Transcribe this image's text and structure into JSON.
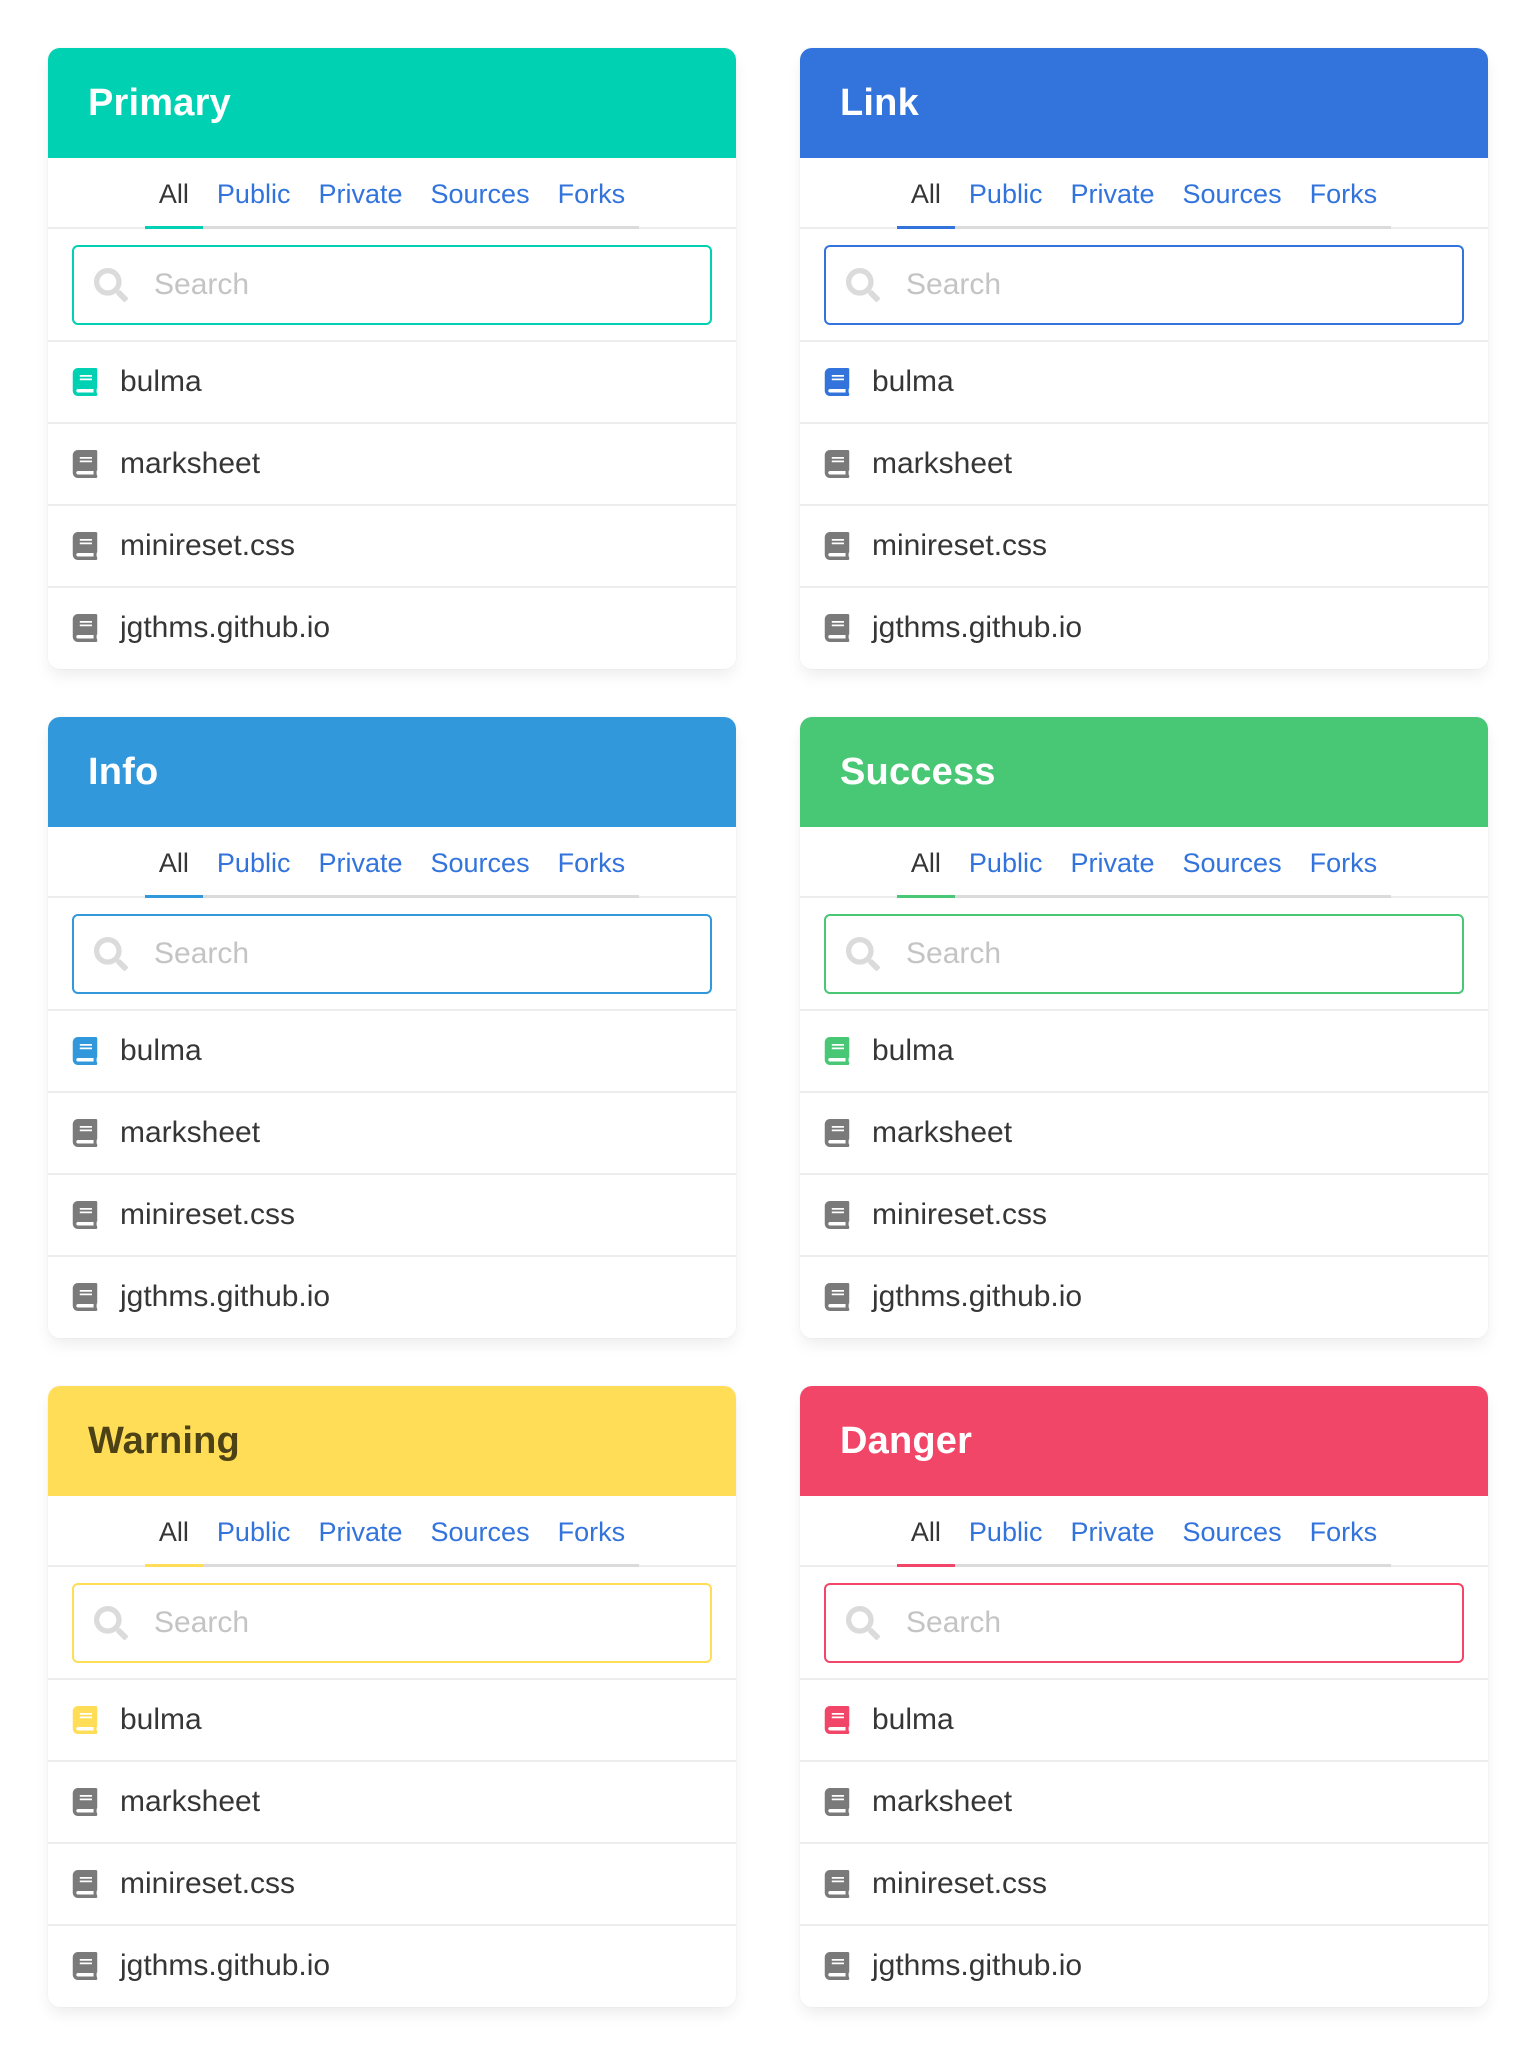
{
  "tabs": [
    "All",
    "Public",
    "Private",
    "Sources",
    "Forks"
  ],
  "active_tab": "All",
  "search_placeholder": "Search",
  "repos": [
    "bulma",
    "marksheet",
    "minireset.css",
    "jgthms.github.io"
  ],
  "icons": {
    "search": "search-icon",
    "repo": "book-icon"
  },
  "neutral_icon_color": "#7a7a7a",
  "tab_link_color": "#3273dc",
  "panels": [
    {
      "title": "Primary",
      "color": "#00d1b2",
      "title_color": "#ffffff"
    },
    {
      "title": "Link",
      "color": "#3273dc",
      "title_color": "#ffffff"
    },
    {
      "title": "Info",
      "color": "#3298dc",
      "title_color": "#ffffff"
    },
    {
      "title": "Success",
      "color": "#48c774",
      "title_color": "#ffffff"
    },
    {
      "title": "Warning",
      "color": "#ffdd57",
      "title_color": "#4d4216"
    },
    {
      "title": "Danger",
      "color": "#f14668",
      "title_color": "#ffffff"
    }
  ]
}
